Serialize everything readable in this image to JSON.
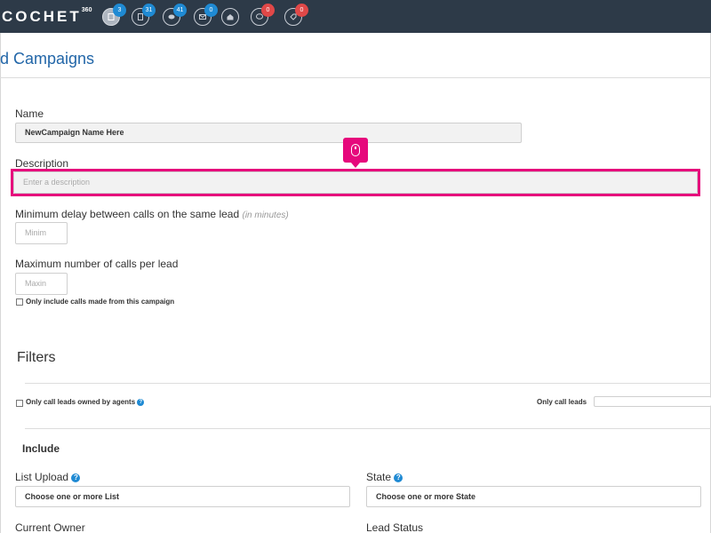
{
  "app": {
    "brand": "COCHET",
    "brand_sup": "360",
    "nav": [
      {
        "icon": "document-icon",
        "badge": "3",
        "badge_color": "blue",
        "active": true
      },
      {
        "icon": "file-icon",
        "badge": "31",
        "badge_color": "blue",
        "active": false
      },
      {
        "icon": "chat-icon",
        "badge": "41",
        "badge_color": "blue",
        "active": false
      },
      {
        "icon": "mail-icon",
        "badge": "0",
        "badge_color": "blue",
        "active": false
      },
      {
        "icon": "inbox-icon",
        "badge": "",
        "badge_color": "",
        "active": false
      },
      {
        "icon": "speech-bubble-icon",
        "badge": "0",
        "badge_color": "red",
        "active": false
      },
      {
        "icon": "tag-icon",
        "badge": "0",
        "badge_color": "red",
        "active": false
      }
    ]
  },
  "page": {
    "title": "d Campaigns"
  },
  "form": {
    "name_label": "Name",
    "name_value": "NewCampaign Name Here",
    "description_label": "Description",
    "description_placeholder": "Enter a description",
    "min_delay_label": "Minimum delay between calls on the same lead",
    "min_delay_hint": "(in minutes)",
    "min_delay_placeholder": "Minim",
    "max_calls_label": "Maximum number of calls per lead",
    "max_calls_placeholder": "Maxin",
    "only_include_label": "Only include calls made from this campaign"
  },
  "filters": {
    "title": "Filters",
    "owned_by_agents_label": "Only call leads owned by agents",
    "only_call_leads_label": "Only call leads",
    "include_title": "Include",
    "list_upload_label": "List Upload",
    "list_upload_placeholder": "Choose one or more List",
    "state_label": "State",
    "state_placeholder": "Choose one or more State",
    "current_owner_label": "Current Owner",
    "lead_status_label": "Lead Status"
  },
  "colors": {
    "topbar": "#2d3a48",
    "accent": "#2266a8",
    "highlight": "#e6087c",
    "badge_blue": "#1f8ad3",
    "badge_red": "#e04848"
  }
}
